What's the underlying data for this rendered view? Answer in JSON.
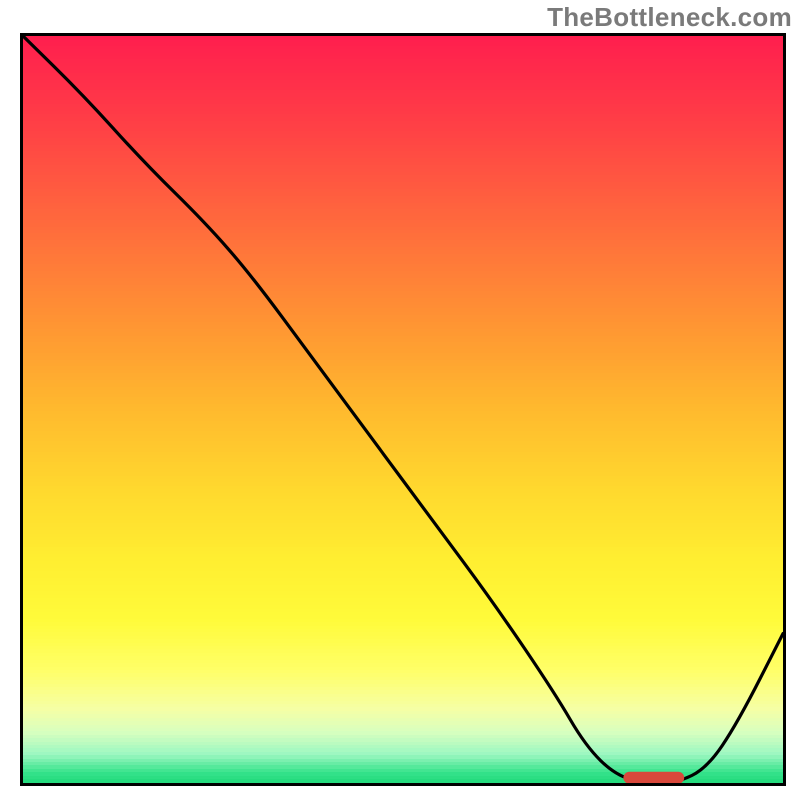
{
  "watermark": "TheBottleneck.com",
  "chart_data": {
    "type": "line",
    "title": "",
    "xlabel": "",
    "ylabel": "",
    "xlim": [
      0,
      100
    ],
    "ylim": [
      0,
      100
    ],
    "grid": false,
    "legend": false,
    "series": [
      {
        "name": "bottleneck-curve",
        "x": [
          0,
          8,
          16,
          24,
          30,
          38,
          46,
          54,
          62,
          70,
          74,
          78,
          82,
          86,
          90,
          94,
          100
        ],
        "y": [
          100,
          92,
          83,
          75,
          68,
          57,
          46,
          35,
          24,
          12,
          5,
          1,
          0,
          0,
          2,
          8,
          20
        ],
        "color": "#000000"
      }
    ],
    "marker": {
      "name": "optimal-range-marker",
      "x_start": 79,
      "x_end": 87,
      "y": 0.7,
      "color": "#d9483b"
    },
    "gradient_stops": [
      {
        "pos": 0.0,
        "color": "#ff1f4e"
      },
      {
        "pos": 0.1,
        "color": "#ff3a47"
      },
      {
        "pos": 0.2,
        "color": "#ff5a40"
      },
      {
        "pos": 0.3,
        "color": "#ff7a39"
      },
      {
        "pos": 0.4,
        "color": "#ff9a32"
      },
      {
        "pos": 0.5,
        "color": "#ffba2e"
      },
      {
        "pos": 0.6,
        "color": "#ffd72e"
      },
      {
        "pos": 0.7,
        "color": "#ffee31"
      },
      {
        "pos": 0.78,
        "color": "#fffb3a"
      },
      {
        "pos": 0.85,
        "color": "#ffff6a"
      },
      {
        "pos": 0.9,
        "color": "#f5ffa6"
      },
      {
        "pos": 0.93,
        "color": "#d8ffbf"
      },
      {
        "pos": 0.96,
        "color": "#9cf7c1"
      },
      {
        "pos": 0.985,
        "color": "#34e28a"
      },
      {
        "pos": 1.0,
        "color": "#1fd879"
      }
    ]
  }
}
